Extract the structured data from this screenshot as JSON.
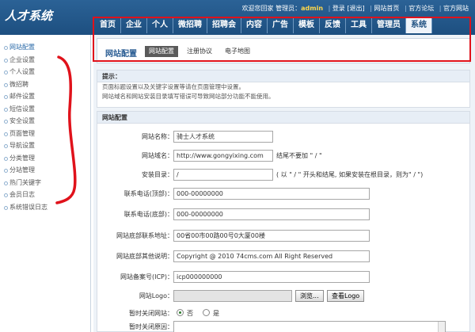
{
  "header": {
    "logo": "人才系统",
    "welcome": "欢迎您回家 管理员：",
    "admin": "admin",
    "login": "登录",
    "logout": "[退出]",
    "home": "网站首页",
    "forum": "官方论坛",
    "official": "官方网站",
    "sep": "|"
  },
  "nav": {
    "tabs": [
      "首页",
      "企业",
      "个人",
      "微招聘",
      "招聘会",
      "内容",
      "广告",
      "模板",
      "反馈",
      "工具",
      "管理员",
      "系统"
    ],
    "active_index": 11
  },
  "sidebar": {
    "items": [
      "网站配置",
      "企业设置",
      "个人设置",
      "微招聘",
      "邮件设置",
      "短信设置",
      "安全设置",
      "页面管理",
      "导航设置",
      "分类管理",
      "分站管理",
      "热门关键字",
      "会员日志",
      "系统错误日志"
    ],
    "active_index": 0
  },
  "subnav": {
    "title": "网站配置",
    "chips": [
      "网站配置",
      "注册协议",
      "电子地图"
    ],
    "active_index": 0
  },
  "tips": {
    "title": "提示：",
    "line1": "页面标题设置以及关键字设置等请在页面管理中设置。",
    "line2": "网站域名和网站安装目录填写错误可导致网站部分功能不能使用。"
  },
  "form": {
    "title": "网站配置",
    "site_name_label": "网站名称：",
    "site_name_value": "骑士人才系统",
    "domain_label": "网站域名：",
    "domain_value": "http://www.gongyixing.com",
    "domain_hint": "结尾不要加 \" / \"",
    "install_label": "安装目录：",
    "install_value": "/",
    "install_hint": "( 以 \" / \" 开头和结尾, 如果安装在根目录，则为\" / \")",
    "tel_top_label": "联系电话(顶部)：",
    "tel_top_value": "000-00000000",
    "tel_bottom_label": "联系电话(底部)：",
    "tel_bottom_value": "000-00000000",
    "address_label": "网站底部联系地址：",
    "address_value": "00省00市00路00号0大厦00楼",
    "other_label": "网站底部其他说明：",
    "other_value": "Copyright @ 2010 74cms.com All Right Reserved",
    "icp_label": "网站备案号(ICP)：",
    "icp_value": "icp000000000",
    "logo_label": "网站Logo：",
    "browse_btn": "浏览...",
    "view_logo_btn": "查看Logo",
    "close_label": "暂时关闭网站：",
    "radio_no": "否",
    "radio_yes": "是",
    "close_reason_label": "暂时关闭原因："
  },
  "colors": {
    "header_blue": "#1d4f80",
    "annotation_red": "#e0121b",
    "admin_yellow": "#ffd84a"
  }
}
